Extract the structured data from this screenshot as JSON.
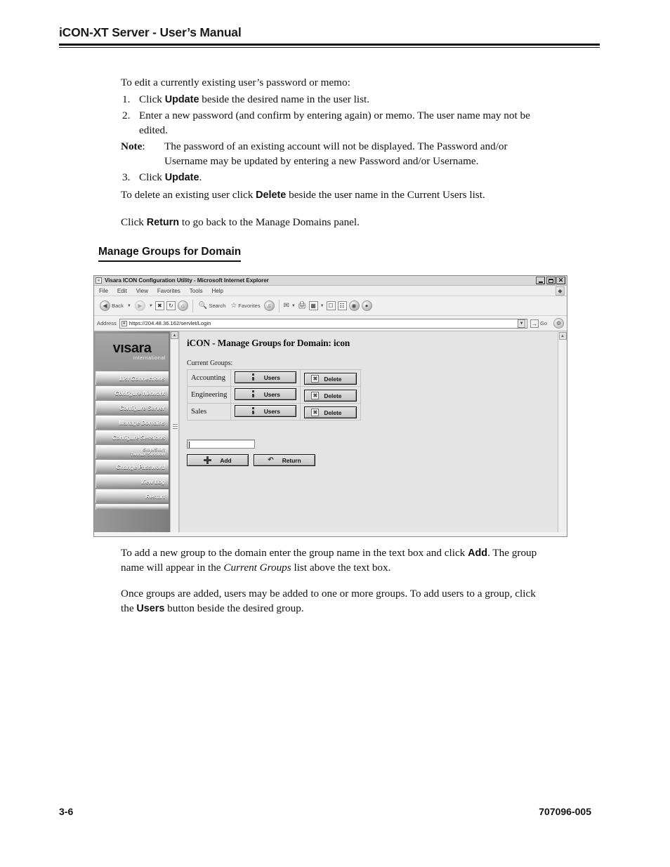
{
  "document": {
    "header_title": "iCON-XT Server - User’s Manual",
    "footer_page": "3-6",
    "footer_doc_number": "707096-005"
  },
  "intro": {
    "lead": "To edit a currently existing user’s password or memo:",
    "steps": [
      {
        "num": "1.",
        "pre": "Click ",
        "bold": "Update",
        "post": " beside the desired name in the user list."
      },
      {
        "num": "2.",
        "pre": "Enter a new password (and confirm by entering again) or memo. The user name may not be edited.",
        "bold": "",
        "post": ""
      },
      {
        "num": "3.",
        "pre": "Click ",
        "bold": "Update",
        "post": "."
      }
    ],
    "note_label": "Note",
    "note_colon": ":",
    "note_text": "The password of an existing account will not be displayed. The Password and/or Username may be updated by entering a new Password and/or Username.",
    "delete_pre": "To delete an existing user click ",
    "delete_bold": "Delete",
    "delete_post": " beside the user name in the Current Users list.",
    "return_pre": "Click ",
    "return_bold": "Return",
    "return_post": " to go back to the Manage Domains panel."
  },
  "section": {
    "heading": "Manage Groups for Domain"
  },
  "browser": {
    "window_title": "Visara ICON Configuration Utility - Microsoft Internet Explorer",
    "window_icon": "ie-page-icon",
    "window_controls": [
      {
        "name": "minimize-button",
        "glyph": "—"
      },
      {
        "name": "restore-button",
        "glyph": "❐"
      },
      {
        "name": "close-button",
        "glyph": "✕"
      }
    ],
    "menu_items": [
      "File",
      "Edit",
      "View",
      "Favorites",
      "Tools",
      "Help"
    ],
    "toolbar": {
      "back_label": "Back",
      "search_label": "Search",
      "favorites_label": "Favorites",
      "items": [
        "back-button",
        "back-dropdown",
        "forward-button",
        "stop-button",
        "refresh-button",
        "home-button",
        "search-button",
        "favorites-button",
        "media-button",
        "mail-button",
        "print-button",
        "edit-button",
        "messenger-button",
        "research-button",
        "globe-button",
        "discuss-button"
      ]
    },
    "address_bar": {
      "label": "Address",
      "url": "https://204.48.36.162/servlet/Login",
      "go_label": "Go"
    }
  },
  "web_page": {
    "logo": {
      "main": "vısara",
      "sub": "international"
    },
    "nav_items": [
      {
        "label": "List Connections",
        "two_line": false
      },
      {
        "label": "Configure Network",
        "two_line": false
      },
      {
        "label": "Configure Server",
        "two_line": false
      },
      {
        "label": "Manage Domains",
        "two_line": false
      },
      {
        "label": "Configure Sessions",
        "two_line": false
      },
      {
        "label": "Stop/Start",
        "label2": "Twinax Session",
        "two_line": true
      },
      {
        "label": "Change Password",
        "two_line": false
      },
      {
        "label": "View Log",
        "two_line": false
      },
      {
        "label": "Restart",
        "two_line": false
      }
    ],
    "title": "iCON - Manage Groups for Domain: icon",
    "current_groups_label": "Current Groups:",
    "groups": [
      {
        "name": "Accounting",
        "users_label": "Users",
        "delete_label": "Delete"
      },
      {
        "name": "Engineering",
        "users_label": "Users",
        "delete_label": "Delete"
      },
      {
        "name": "Sales",
        "users_label": "Users",
        "delete_label": "Delete"
      }
    ],
    "new_group_input_value": "",
    "add_label": "Add",
    "return_label": "Return"
  },
  "outro": {
    "p1_a": "To add a new group to the domain enter the group name in the text box and click ",
    "p1_bold": "Add",
    "p1_b": ". The group name will appear in the ",
    "p1_italic": "Current Groups",
    "p1_c": " list above the text box.",
    "p2_a": "Once groups are added, users may be added to one or more groups. To add users to a group, click the ",
    "p2_bold": "Users",
    "p2_b": " button beside the desired group."
  }
}
